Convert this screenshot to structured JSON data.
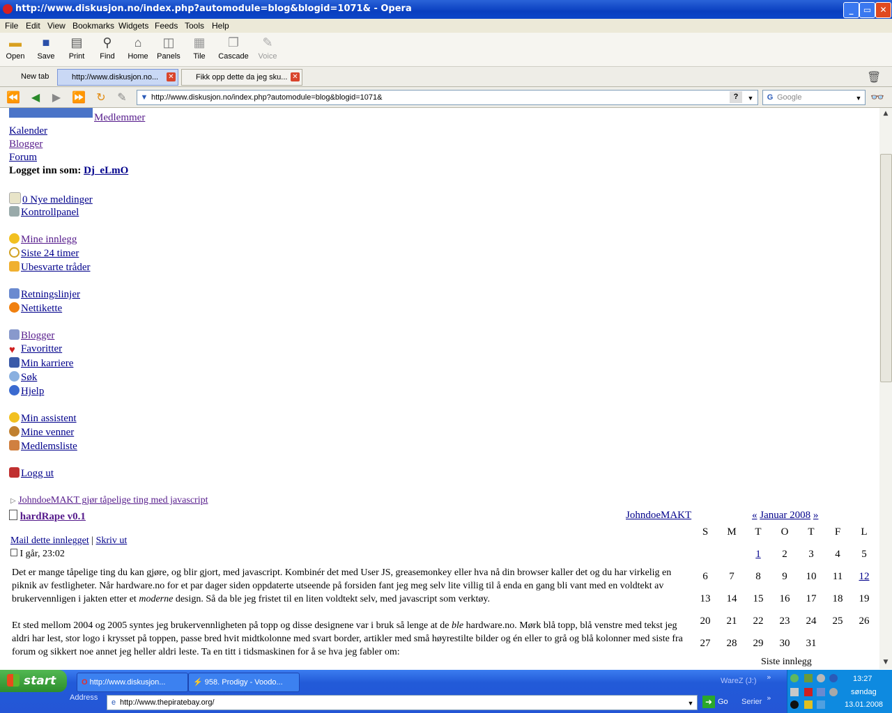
{
  "window": {
    "title": "http://www.diskusjon.no/index.php?automodule=blog&blogid=1071& - Opera",
    "min": "_",
    "max": "▭",
    "close": "✕"
  },
  "menu": [
    "File",
    "Edit",
    "View",
    "Bookmarks",
    "Widgets",
    "Feeds",
    "Tools",
    "Help"
  ],
  "toolbar": {
    "open": "Open",
    "save": "Save",
    "print": "Print",
    "find": "Find",
    "home": "Home",
    "panels": "Panels",
    "tile": "Tile",
    "cascade": "Cascade",
    "voice": "Voice"
  },
  "tabs": {
    "new_tab": "New tab",
    "tab1": "http://www.diskusjon.no...",
    "tab2": "Fikk opp dette da jeg sku..."
  },
  "address": {
    "url": "http://www.diskusjon.no/index.php?automodule=blog&blogid=1071&",
    "search_placeholder": "Google",
    "help": "?"
  },
  "sidebar": {
    "medlemmer": "Medlemmer",
    "kalender": "Kalender",
    "blogger_top": "Blogger",
    "forum": "Forum",
    "logged_in_label": "Logget inn som:",
    "username": "Dj_eLmO",
    "items": [
      {
        "label": "0 Nye meldinger"
      },
      {
        "label": "Kontrollpanel"
      },
      {
        "label": "Mine innlegg"
      },
      {
        "label": "Siste 24 timer"
      },
      {
        "label": "Ubesvarte tråder"
      },
      {
        "label": "Retningslinjer"
      },
      {
        "label": "Nettikette"
      },
      {
        "label": "Blogger"
      },
      {
        "label": "Favoritter"
      },
      {
        "label": "Min karriere"
      },
      {
        "label": "Søk"
      },
      {
        "label": "Hjelp"
      },
      {
        "label": "Min assistent"
      },
      {
        "label": "Mine venner"
      },
      {
        "label": "Medlemsliste"
      },
      {
        "label": "Logg ut"
      }
    ]
  },
  "blog": {
    "breadcrumb": "JohndoeMAKT gjør tåpelige ting med javascript",
    "title": "hardRape v0.1",
    "author": "JohndoeMAKT",
    "mail": "Mail dette innlegget",
    "sep": "|",
    "write": "Skriv ut",
    "date": "I går, 23:02",
    "p1a": "Det er mange tåpelige ting du kan gjøre, og blir gjort, med javascript. Kombinér det med User JS, greasemonkey eller hva nå din browser kaller det og du har virkelig en piknik av festligheter. Når hardware.no for et par dager siden oppdaterte utseende på forsiden fant jeg meg selv lite villig til å enda en gang bli vant med en voldtekt av brukervennligen i jakten etter et ",
    "p1em": "moderne",
    "p1b": " design. Så da ble jeg fristet til en liten voldtekt selv, med javascript som verktøy.",
    "p2a": "Et sted mellom 2004 og 2005 syntes jeg brukervennligheten på topp og disse designene var i bruk så lenge at de ",
    "p2em": "ble",
    "p2b": " hardware.no. Mørk blå topp, blå venstre med tekst jeg aldri har lest, stor logo i krysset på toppen, passe bred hvit midtkolonne med svart border, artikler med små høyrestilte bilder og én eller to grå og blå kolonner med siste fra forum og sikkert noe annet jeg heller aldri leste. Ta en titt i tidsmaskinen for å se hva jeg fabler om:"
  },
  "calendar": {
    "prev": "«",
    "month": "Januar 2008",
    "next": "»",
    "days": [
      "S",
      "M",
      "T",
      "O",
      "T",
      "F",
      "L"
    ],
    "weeks": [
      [
        "",
        "",
        "1",
        "2",
        "3",
        "4",
        "5"
      ],
      [
        "6",
        "7",
        "8",
        "9",
        "10",
        "11",
        "12"
      ],
      [
        "13",
        "14",
        "15",
        "16",
        "17",
        "18",
        "19"
      ],
      [
        "20",
        "21",
        "22",
        "23",
        "24",
        "25",
        "26"
      ],
      [
        "27",
        "28",
        "29",
        "30",
        "31",
        "",
        ""
      ]
    ],
    "siste": "Siste innlegg"
  },
  "taskbar": {
    "start": "start",
    "task1": "http://www.diskusjon...",
    "task2": "958. Prodigy - Voodo...",
    "waresz": "WareZ (J:)",
    "address_label": "Address",
    "address_url": "http://www.thepiratebay.org/",
    "go": "Go",
    "serier": "Serier",
    "time": "13:27",
    "day": "søndag",
    "date": "13.01.2008"
  }
}
